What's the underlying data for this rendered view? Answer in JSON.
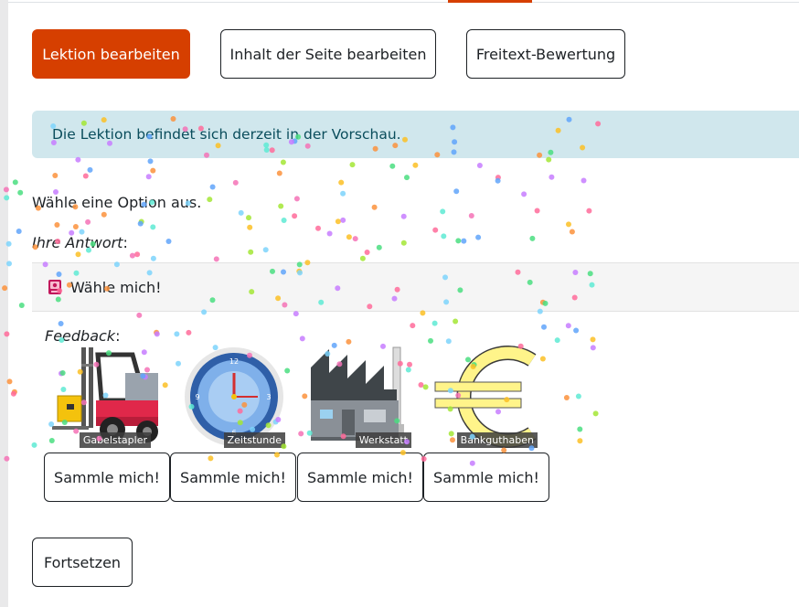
{
  "actions": {
    "edit_lesson": "Lektion bearbeiten",
    "edit_page": "Inhalt der Seite bearbeiten",
    "essay_grading": "Freitext-Bewertung"
  },
  "alert": {
    "text": "Die Lektion befindet sich derzeit in der Vorschau."
  },
  "question": {
    "prompt": "Wähle eine Option aus.",
    "your_answer_label": "Ihre Antwort",
    "your_answer_suffix": ":",
    "answer_text": "Wähle mich!",
    "feedback_label": "Feedback",
    "feedback_suffix": ":"
  },
  "items": [
    {
      "caption": "Gabelstapler",
      "button": "Sammle mich!",
      "icon": "forklift-icon"
    },
    {
      "caption": "Zeitstunde",
      "button": "Sammle mich!",
      "icon": "clock-icon"
    },
    {
      "caption": "Werkstatt",
      "button": "Sammle mich!",
      "icon": "factory-icon"
    },
    {
      "caption": "Bankguthaben",
      "button": "Sammle mich!",
      "icon": "euro-icon"
    }
  ],
  "continue": "Fortsetzen",
  "colors": {
    "accent": "#d63f00",
    "alert_bg": "#d0e7ed",
    "alert_text": "#0a4d5c"
  }
}
